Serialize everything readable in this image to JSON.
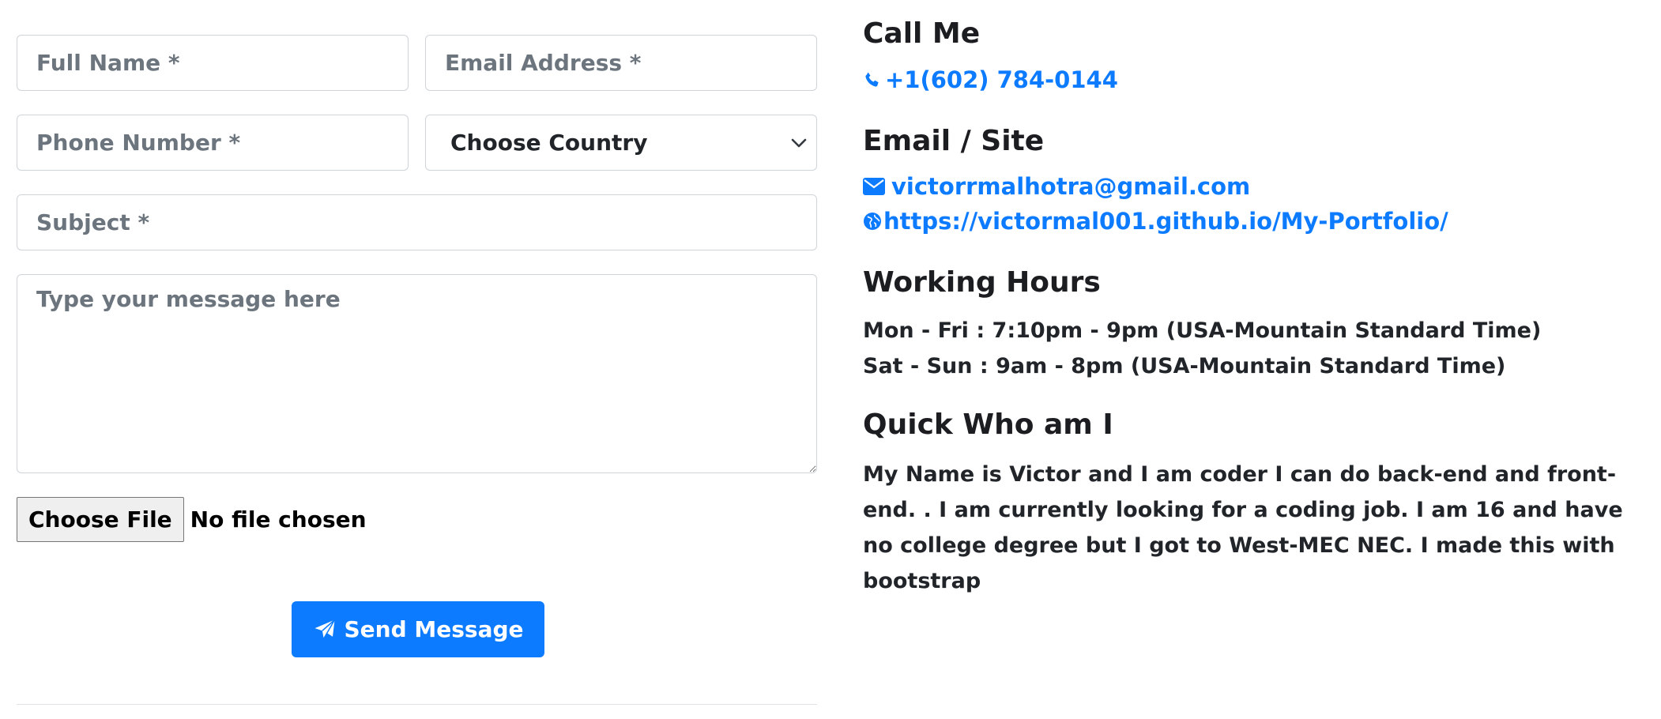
{
  "form": {
    "full_name_placeholder": "Full Name *",
    "email_placeholder": "Email Address *",
    "phone_placeholder": "Phone Number *",
    "country_selected": "Choose Country",
    "subject_placeholder": "Subject *",
    "message_placeholder": "Type your message here",
    "file_button_label": "Choose File",
    "file_status": "No file chosen",
    "send_label": "Send Message",
    "send_icon": "paper-plane-icon"
  },
  "contact": {
    "call_heading": "Call Me",
    "phone": "+1(602) 784-0144",
    "phone_icon": "phone-icon",
    "email_heading": "Email / Site",
    "email": "victorrmalhotra@gmail.com",
    "email_icon": "envelope-icon",
    "site": "https://victormal001.github.io/My-Portfolio/",
    "site_icon": "globe-icon",
    "hours_heading": "Working Hours",
    "hours_weekday": "Mon - Fri : 7:10pm - 9pm (USA-Mountain Standard Time)",
    "hours_weekend": "Sat - Sun : 9am - 8pm (USA-Mountain Standard Time)",
    "about_heading": "Quick Who am I",
    "about_text": "My Name is Victor and I am coder I can do back-end and front-end. . I am currently looking for a coding job. I am 16 and have no college degree but I got to West-MEC NEC. I made this with bootstrap"
  },
  "colors": {
    "accent": "#0d7bff",
    "heading": "#1b1d21",
    "placeholder": "#6c757d",
    "border": "#ced4da"
  }
}
